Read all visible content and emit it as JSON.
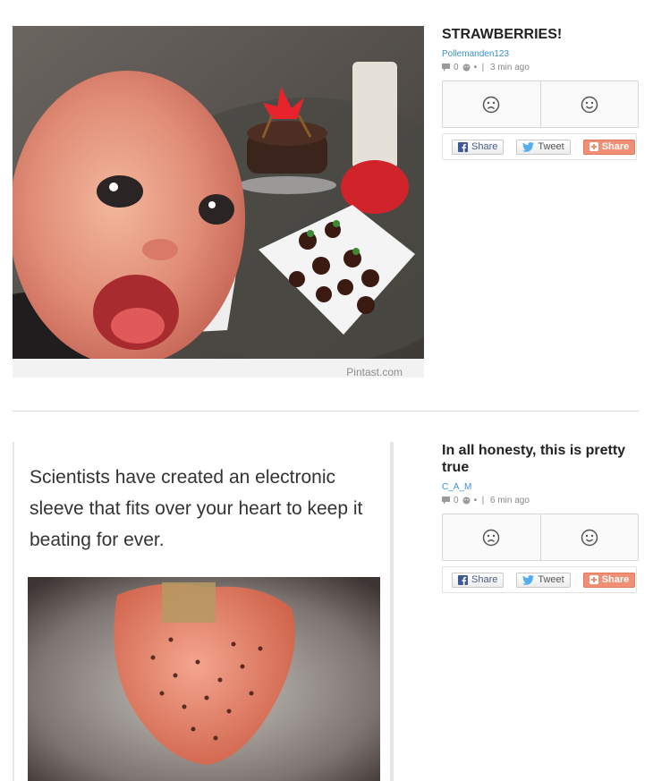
{
  "posts": [
    {
      "title": "STRAWBERRIES!",
      "author": "Pollemanden123",
      "comments": "0",
      "time": "3 min ago",
      "image": {
        "watermark": "Pintast.com"
      },
      "share": {
        "facebook": "Share",
        "twitter": "Tweet",
        "google": "Share"
      },
      "icons": {
        "comment": "comment-icon",
        "emoji": "smiley-icon",
        "sad": "sad-face-icon",
        "happy": "happy-face-icon"
      }
    },
    {
      "title": "In all honesty, this is pretty true",
      "author": "C_A_M",
      "comments": "0",
      "time": "6 min ago",
      "image": {
        "caption": "Scientists have created an electronic sleeve that fits over your heart to keep it beating for ever."
      },
      "share": {
        "facebook": "Share",
        "twitter": "Tweet",
        "google": "Share"
      },
      "icons": {
        "comment": "comment-icon",
        "emoji": "smiley-icon",
        "sad": "sad-face-icon",
        "happy": "happy-face-icon"
      }
    }
  ],
  "colors": {
    "author_link": "#3a8fd0",
    "google_share": "#f08f73",
    "facebook": "#3b5998",
    "twitter": "#55acee"
  }
}
